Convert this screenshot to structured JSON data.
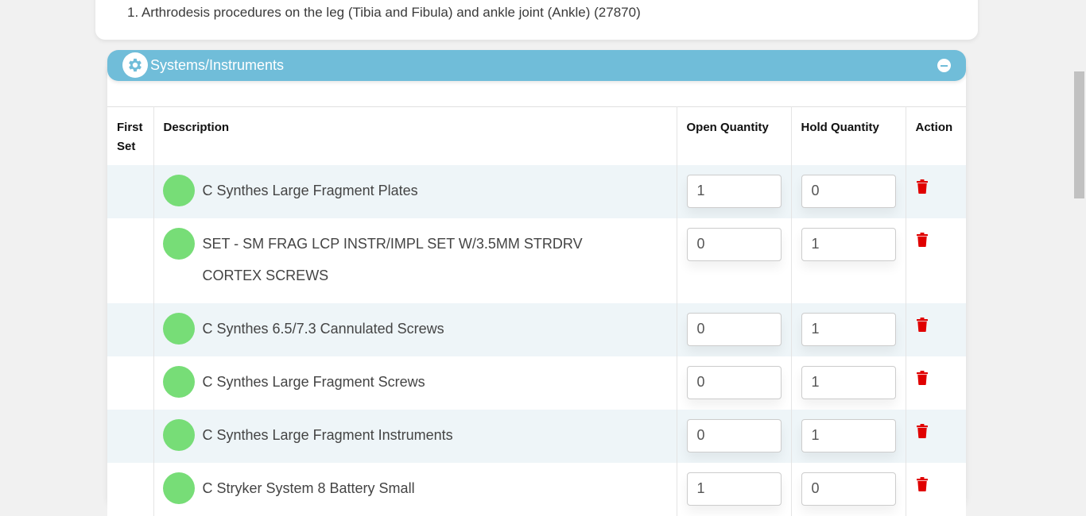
{
  "procedure": {
    "line": "1. Arthrodesis procedures on the leg (Tibia and Fibula) and ankle joint (Ankle) (27870)"
  },
  "section": {
    "title": "Systems/Instruments",
    "icon": "gear-icon",
    "header_color": "#70bdd9"
  },
  "table": {
    "headers": {
      "first_set": "First Set",
      "description": "Description",
      "open_quantity": "Open Quantity",
      "hold_quantity": "Hold Quantity",
      "action": "Action"
    },
    "rows": [
      {
        "description": "C Synthes Large Fragment Plates",
        "open_qty": "1",
        "hold_qty": "0",
        "status_color": "#77dd77"
      },
      {
        "description": "SET - SM FRAG LCP INSTR/IMPL SET W/3.5MM STRDRV CORTEX SCREWS",
        "open_qty": "0",
        "hold_qty": "1",
        "status_color": "#77dd77"
      },
      {
        "description": "C Synthes 6.5/7.3 Cannulated Screws",
        "open_qty": "0",
        "hold_qty": "1",
        "status_color": "#77dd77"
      },
      {
        "description": "C Synthes Large Fragment Screws",
        "open_qty": "0",
        "hold_qty": "1",
        "status_color": "#77dd77"
      },
      {
        "description": "C Synthes Large Fragment Instruments",
        "open_qty": "0",
        "hold_qty": "1",
        "status_color": "#77dd77"
      },
      {
        "description": "C Stryker System 8 Battery Small",
        "open_qty": "1",
        "hold_qty": "0",
        "status_color": "#77dd77"
      }
    ],
    "delete_icon_color": "#e00000"
  }
}
